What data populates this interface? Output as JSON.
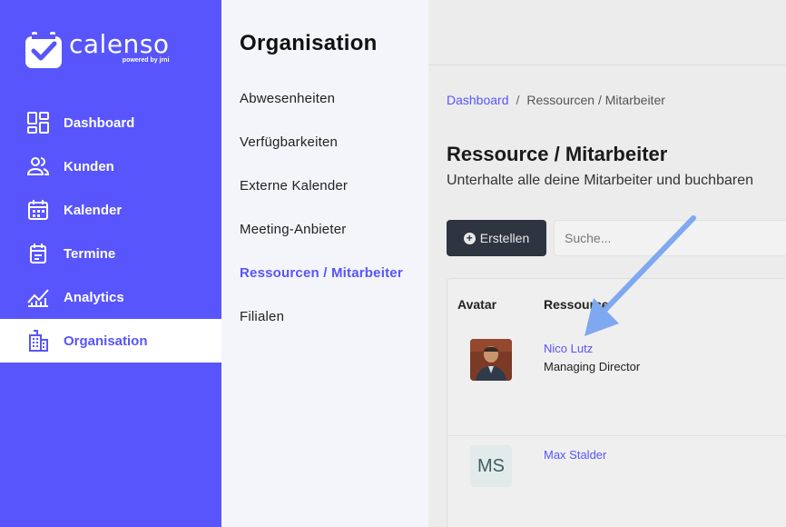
{
  "brand": {
    "name": "calenso",
    "powered_by": "powered by jrni"
  },
  "sidebar": {
    "items": [
      {
        "label": "Dashboard",
        "icon": "dashboard-icon"
      },
      {
        "label": "Kunden",
        "icon": "customers-icon"
      },
      {
        "label": "Kalender",
        "icon": "calendar-icon"
      },
      {
        "label": "Termine",
        "icon": "appointments-icon"
      },
      {
        "label": "Analytics",
        "icon": "analytics-icon"
      },
      {
        "label": "Organisation",
        "icon": "building-icon",
        "active": true
      }
    ]
  },
  "subnav": {
    "title": "Organisation",
    "items": [
      {
        "label": "Abwesenheiten"
      },
      {
        "label": "Verfügbarkeiten"
      },
      {
        "label": "Externe Kalender"
      },
      {
        "label": "Meeting-Anbieter"
      },
      {
        "label": "Ressourcen / Mitarbeiter",
        "active": true
      },
      {
        "label": "Filialen"
      }
    ]
  },
  "main": {
    "breadcrumb": {
      "home": "Dashboard",
      "current": "Ressourcen / Mitarbeiter"
    },
    "title": "Ressource / Mitarbeiter",
    "subtitle": "Unterhalte alle deine Mitarbeiter und buchbaren",
    "create_label": "Erstellen",
    "search_placeholder": "Suche...",
    "table": {
      "headers": [
        "Avatar",
        "Ressource"
      ],
      "rows": [
        {
          "name": "Nico Lutz",
          "role": "Managing Director",
          "avatar": "photo"
        },
        {
          "name": "Max Stalder",
          "role": "",
          "avatar": "MS"
        }
      ]
    }
  },
  "colors": {
    "primary": "#5755fb",
    "subnav_bg": "#f4f5fb",
    "button_dark": "#2e3440",
    "arrow": "#7ea8f0"
  }
}
